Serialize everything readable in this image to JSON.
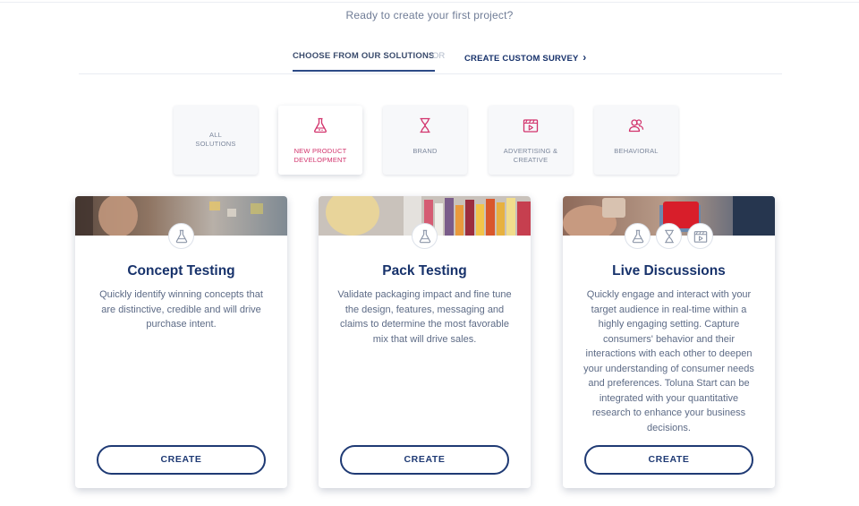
{
  "intro": "Ready to create your first project?",
  "tabs": {
    "choose": "CHOOSE FROM OUR SOLUTIONS",
    "or": "OR",
    "custom": "CREATE CUSTOM SURVEY",
    "custom_chevron": "›"
  },
  "categories": [
    {
      "label": "ALL SOLUTIONS",
      "icon": "none",
      "selected": false
    },
    {
      "label": "NEW PRODUCT DEVELOPMENT",
      "icon": "flask-icon",
      "selected": true
    },
    {
      "label": "BRAND",
      "icon": "hourglass-icon",
      "selected": false
    },
    {
      "label": "ADVERTISING & CREATIVE",
      "icon": "video-clapper-icon",
      "selected": false
    },
    {
      "label": "BEHAVIORAL",
      "icon": "people-icon",
      "selected": false
    }
  ],
  "cards": [
    {
      "title": "Concept Testing",
      "description": "Quickly identify winning concepts that are distinctive, credible and will drive purchase intent.",
      "button": "CREATE",
      "badges": [
        "flask-icon"
      ]
    },
    {
      "title": "Pack Testing",
      "description": "Validate packaging impact and fine tune the design, features, messaging and claims to determine the most favorable mix that will drive sales.",
      "button": "CREATE",
      "badges": [
        "flask-icon"
      ]
    },
    {
      "title": "Live Discussions",
      "description": "Quickly engage and interact with your target audience in real-time within a highly engaging setting. Capture consumers' behavior and their interactions with each other to deepen your understanding of consumer needs and preferences. Toluna Start can be integrated with your quantitative research to enhance your business decisions.",
      "button": "CREATE",
      "badges": [
        "flask-icon",
        "hourglass-icon",
        "video-clapper-icon"
      ]
    }
  ],
  "colors": {
    "accent": "#d2336c",
    "primary": "#17326b",
    "text": "#5d6b86"
  }
}
